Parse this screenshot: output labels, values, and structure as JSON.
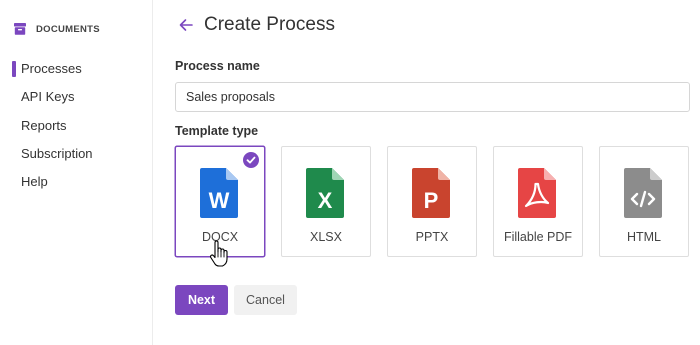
{
  "sidebar": {
    "brand": "DOCUMENTS",
    "brand_icon": "archive-box-icon",
    "items": [
      {
        "label": "Processes",
        "active": true
      },
      {
        "label": "API Keys",
        "active": false
      },
      {
        "label": "Reports",
        "active": false
      },
      {
        "label": "Subscription",
        "active": false
      },
      {
        "label": "Help",
        "active": false
      }
    ]
  },
  "header": {
    "back_icon": "arrow-left-icon",
    "title": "Create Process"
  },
  "form": {
    "name_label": "Process name",
    "name_value": "Sales proposals",
    "type_label": "Template type",
    "templates": [
      {
        "label": "DOCX",
        "icon": "word-document-icon",
        "glyph": "W",
        "color": "#1e6fd9",
        "selected": true
      },
      {
        "label": "XLSX",
        "icon": "excel-document-icon",
        "glyph": "X",
        "color": "#1f8a4c",
        "selected": false
      },
      {
        "label": "PPTX",
        "icon": "powerpoint-document-icon",
        "glyph": "P",
        "color": "#c9442e",
        "selected": false
      },
      {
        "label": "Fillable PDF",
        "icon": "pdf-document-icon",
        "glyph": "",
        "color": "#e64545",
        "selected": false
      },
      {
        "label": "HTML",
        "icon": "html-document-icon",
        "glyph": "</>",
        "color": "#8c8c8c",
        "selected": false
      }
    ],
    "next_label": "Next",
    "cancel_label": "Cancel"
  },
  "colors": {
    "accent": "#7b47bf",
    "border": "#dedede"
  }
}
